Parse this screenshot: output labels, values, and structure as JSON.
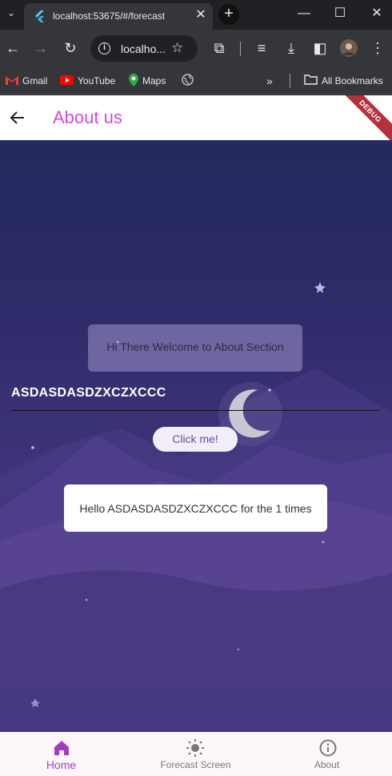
{
  "browser": {
    "tab_title": "localhost:53675/#/forecast",
    "address": "localho...",
    "bookmarks": [
      {
        "label": "Gmail"
      },
      {
        "label": "YouTube"
      },
      {
        "label": "Maps"
      },
      {
        "label": "All Bookmarks"
      }
    ]
  },
  "app": {
    "title": "About us",
    "debug_banner": "DEBUG",
    "welcome": "Hi There Welcome to About Section",
    "name_value": "ASDASDASDZXCZXCCC",
    "button_label": "Click me!",
    "result": "Hello ASDASDASDZXCZXCCC for the 1 times",
    "accent_color": "#d14adf"
  },
  "bottom_nav": {
    "items": [
      {
        "label": "Home",
        "icon": "home-icon",
        "active": true
      },
      {
        "label": "Forecast Screen",
        "icon": "sun-icon",
        "active": false
      },
      {
        "label": "About",
        "icon": "info-icon",
        "active": false
      }
    ]
  }
}
